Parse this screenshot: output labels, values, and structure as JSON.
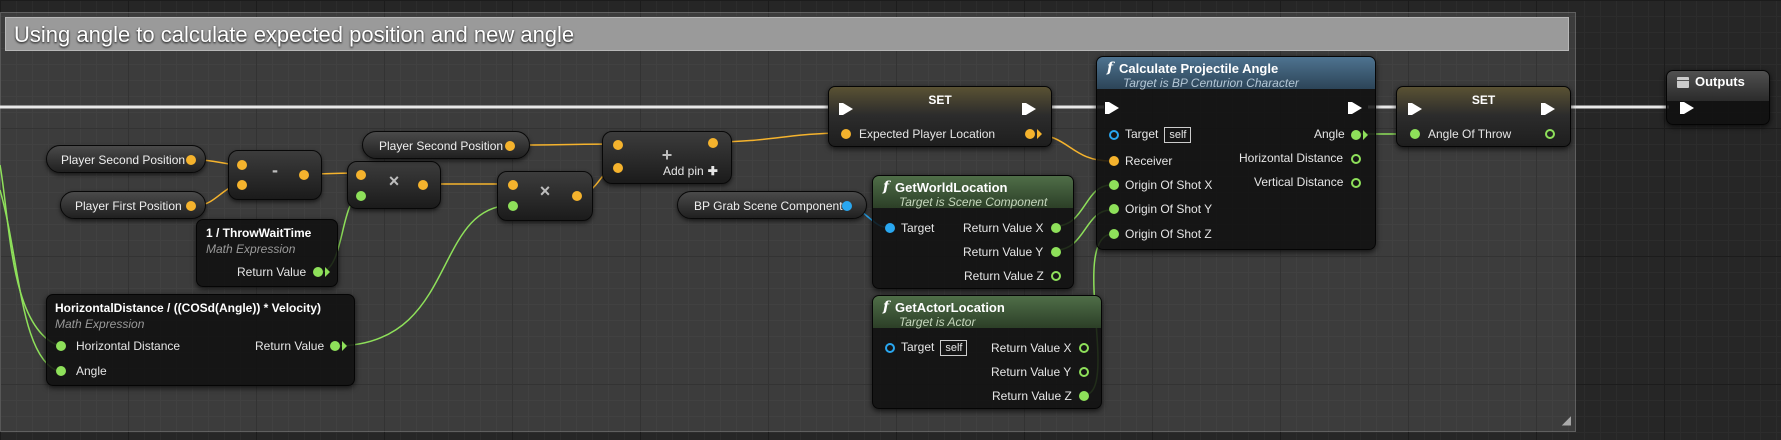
{
  "comment": {
    "title": "Using angle to calculate expected position and new angle"
  },
  "variables": {
    "player_second_position_a": "Player Second Position",
    "player_first_position": "Player First Position",
    "player_second_position_b": "Player Second Position",
    "bp_grab_scene_component": "BP Grab Scene Component"
  },
  "operators": {
    "subtract": "-",
    "multiply_a": "×",
    "multiply_b": "×",
    "add": "+",
    "add_pin": "Add pin"
  },
  "math_throw_wait": {
    "title": "1 / ThrowWaitTime",
    "subtitle": "Math Expression",
    "return_value": "Return Value"
  },
  "math_horizontal": {
    "title": "HorizontalDistance / ((COSd(Angle)) * Velocity)",
    "subtitle": "Math Expression",
    "input_horizontal_distance": "Horizontal Distance",
    "input_angle": "Angle",
    "return_value": "Return Value"
  },
  "set_expected": {
    "title": "SET",
    "variable": "Expected Player Location"
  },
  "get_world_location": {
    "title": "GetWorldLocation",
    "subtitle": "Target is Scene Component",
    "target": "Target",
    "return_x": "Return Value X",
    "return_y": "Return Value Y",
    "return_z": "Return Value Z"
  },
  "get_actor_location": {
    "title": "GetActorLocation",
    "subtitle": "Target is Actor",
    "target": "Target",
    "self": "self",
    "return_x": "Return Value X",
    "return_y": "Return Value Y",
    "return_z": "Return Value Z"
  },
  "calc_angle": {
    "title": "Calculate Projectile Angle",
    "subtitle": "Target is BP Centurion Character",
    "target": "Target",
    "self": "self",
    "receiver": "Receiver",
    "origin_x": "Origin Of Shot X",
    "origin_y": "Origin Of Shot Y",
    "origin_z": "Origin Of Shot Z",
    "angle": "Angle",
    "horizontal_distance": "Horizontal Distance",
    "vertical_distance": "Vertical Distance"
  },
  "set_angle": {
    "title": "SET",
    "variable": "Angle Of Throw"
  },
  "outputs": {
    "title": "Outputs"
  },
  "colors": {
    "vector_pin": "#f5b32d",
    "float_pin": "#8ee05a",
    "object_pin": "#29a7f0",
    "function_header": "#4e7390",
    "pure_function_header": "#4f6e48"
  }
}
